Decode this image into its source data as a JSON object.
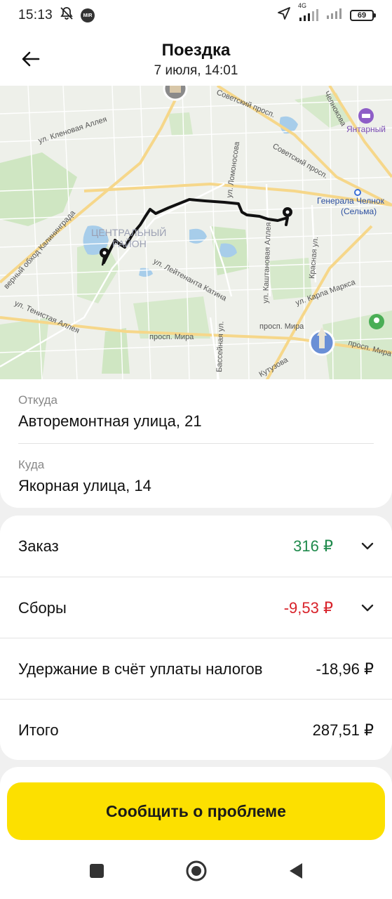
{
  "status_bar": {
    "time": "15:13",
    "network": "4G",
    "battery": "69"
  },
  "header": {
    "title": "Поездка",
    "subtitle": "7 июля, 14:01"
  },
  "map": {
    "labels": {
      "kalinin": "верный обход Калининграда",
      "klenovaya": "ул. Кленовая Аллея",
      "central1": "ЦЕНТРАЛЬНЫЙ",
      "central2": "РАЙОН",
      "sovetsky1": "Советский просп.",
      "sovetsky2": "Советский просп.",
      "lomonosova": "ул. Ломоносова",
      "chelnokova": "Челнокова",
      "yantarny": "Янтарный",
      "station1": "Генерала Челнок",
      "station2": "(Сельма)",
      "kashtanovaya": "ул. Каштановая Аллея",
      "krasnaya": "Красная ул.",
      "marksa": "ул. Карла Маркса",
      "katina": "ул. Лейтенанта Катина",
      "tenistaya": "ул. Тенистая Аллея",
      "mira1": "просп. Мира",
      "mira2": "просп. Мира",
      "mira3": "просп. Мира",
      "basseynaya": "Бассейная ул.",
      "kutuzova": "Кутузова"
    }
  },
  "address": {
    "from_label": "Откуда",
    "from_value": "Авторемонтная улица, 21",
    "to_label": "Куда",
    "to_value": "Якорная улица, 14"
  },
  "pricing": {
    "order_label": "Заказ",
    "order_value": "316 ₽",
    "fees_label": "Сборы",
    "fees_value": "-9,53 ₽",
    "tax_label": "Удержание в счёт уплаты налогов",
    "tax_value": "-18,96 ₽",
    "total_label": "Итого",
    "total_value": "287,51 ₽"
  },
  "actions": {
    "report_label": "Сообщить о проблеме"
  },
  "colors": {
    "accent": "#fce000",
    "positive": "#1f8a4c",
    "negative": "#d8222a"
  }
}
